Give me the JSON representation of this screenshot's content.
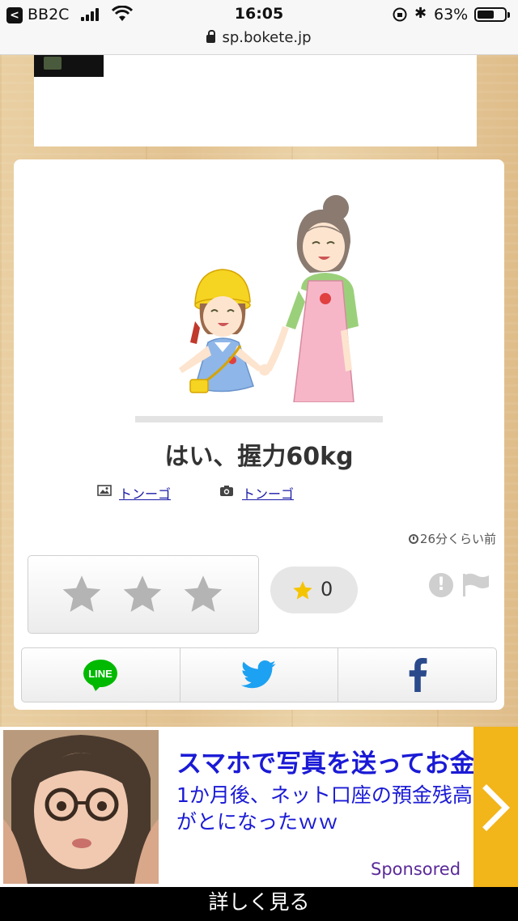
{
  "status_bar": {
    "back_label": "<",
    "carrier": "BB2C",
    "time": "16:05",
    "battery_percent": "63%",
    "battery_level": 0.63,
    "url": "sp.bokete.jp"
  },
  "post": {
    "boke_text": "はい、握力60kg",
    "image_credit": "トンーゴ",
    "photo_credit": "トンーゴ",
    "timestamp": "26分くらい前",
    "rating_stars": 3,
    "favorite_count": "0"
  },
  "share": {
    "line_label": "LINE",
    "twitter_icon": "twitter-icon",
    "facebook_icon": "facebook-icon",
    "line_color": "#00b900",
    "twitter_color": "#1da1f2",
    "facebook_color": "#2b4a8b"
  },
  "ad": {
    "headline": "スマホで写真を送ってお金を稼",
    "body": "1か月後、ネット口座の預金残高がとになったｗｗ",
    "sponsored": "Sponsored",
    "cta": "詳しく見る",
    "accent_color": "#f2b51a"
  }
}
